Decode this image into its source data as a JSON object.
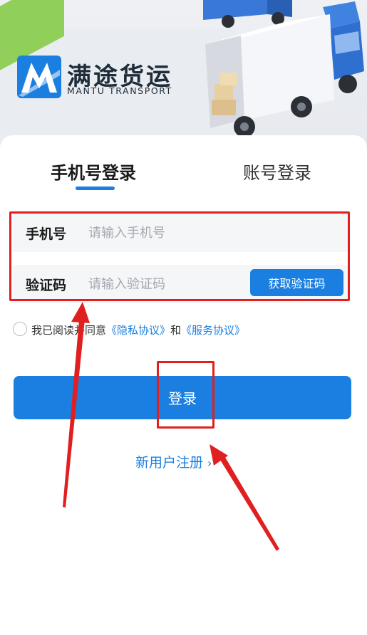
{
  "brand": {
    "name_cn": "满途货运",
    "name_en": "MANTU TRANSPORT"
  },
  "tabs": [
    {
      "label": "手机号登录",
      "active": true
    },
    {
      "label": "账号登录",
      "active": false
    }
  ],
  "form": {
    "phone_label": "手机号",
    "phone_placeholder": "请输入手机号",
    "code_label": "验证码",
    "code_placeholder": "请输入验证码",
    "get_code_button": "获取验证码"
  },
  "agreement": {
    "prefix": "我已阅读并同意",
    "privacy_link": "《隐私协议》",
    "conjunction": "和",
    "service_link": "《服务协议》",
    "checked": false
  },
  "login_button": "登录",
  "register_link": "新用户注册",
  "register_chevron": "›",
  "colors": {
    "accent": "#1a7fe0",
    "annotation": "#e02020",
    "input_bg": "#f5f6f8"
  }
}
